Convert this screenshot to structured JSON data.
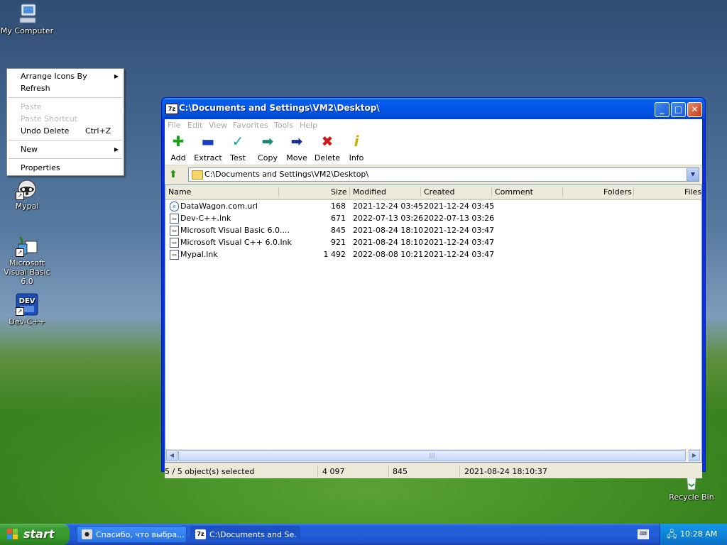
{
  "desktop": {
    "icons": [
      {
        "label": "My Computer"
      },
      {
        "label": "Mypal"
      },
      {
        "label": "Microsoft Visual Basic 6.0"
      },
      {
        "label": "Dev-C++"
      },
      {
        "label": "Recycle Bin"
      }
    ]
  },
  "context_menu": {
    "items": [
      {
        "label": "Arrange Icons By",
        "submenu": true,
        "enabled": true
      },
      {
        "label": "Refresh",
        "enabled": true
      },
      {
        "label": "Paste",
        "enabled": false
      },
      {
        "label": "Paste Shortcut",
        "enabled": false
      },
      {
        "label": "Undo Delete",
        "shortcut": "Ctrl+Z",
        "enabled": true
      },
      {
        "label": "New",
        "submenu": true,
        "enabled": true
      },
      {
        "label": "Properties",
        "enabled": true
      }
    ]
  },
  "window": {
    "title": "C:\\Documents and Settings\\VM2\\Desktop\\",
    "app_icon": "7z",
    "menubar": [
      "File",
      "Edit",
      "View",
      "Favorites",
      "Tools",
      "Help"
    ],
    "toolbar": [
      {
        "label": "Add",
        "icon": "plus-icon",
        "color": "#1aa01a"
      },
      {
        "label": "Extract",
        "icon": "minus-icon",
        "color": "#1a3fc4"
      },
      {
        "label": "Test",
        "icon": "check-icon",
        "color": "#12a5a5"
      },
      {
        "label": "Copy",
        "icon": "arrow-right-icon",
        "color": "#1f8a74"
      },
      {
        "label": "Move",
        "icon": "arrow-right-icon",
        "color": "#1c2f8f"
      },
      {
        "label": "Delete",
        "icon": "x-icon",
        "color": "#d11818"
      },
      {
        "label": "Info",
        "icon": "info-icon",
        "color": "#c8b000"
      }
    ],
    "address": "C:\\Documents and Settings\\VM2\\Desktop\\",
    "columns": [
      "Name",
      "Size",
      "Modified",
      "Created",
      "Comment",
      "Folders",
      "Files"
    ],
    "rows": [
      {
        "name": "DataWagon.com.url",
        "size": "168",
        "modified": "2021-12-24 03:45",
        "created": "2021-12-24 03:45"
      },
      {
        "name": "Dev-C++.lnk",
        "size": "671",
        "modified": "2022-07-13 03:26",
        "created": "2022-07-13 03:26"
      },
      {
        "name": "Microsoft Visual Basic 6.0....",
        "size": "845",
        "modified": "2021-08-24 18:10",
        "created": "2021-12-24 03:47"
      },
      {
        "name": "Microsoft Visual C++ 6.0.lnk",
        "size": "921",
        "modified": "2021-08-24 18:10",
        "created": "2021-12-24 03:47"
      },
      {
        "name": "Mypal.lnk",
        "size": "1 492",
        "modified": "2022-08-08 10:21",
        "created": "2021-12-24 03:47"
      }
    ],
    "status": {
      "selection": "5 / 5 object(s) selected",
      "total_size": "4 097",
      "selected_size": "845",
      "modified": "2021-08-24 18:10:37"
    }
  },
  "taskbar": {
    "start_label": "start",
    "tasks": [
      {
        "label": "Спасибо, что выбра...",
        "active": false
      },
      {
        "label": "C:\\Documents and Se...",
        "active": true
      }
    ],
    "clock": "10:28 AM"
  }
}
